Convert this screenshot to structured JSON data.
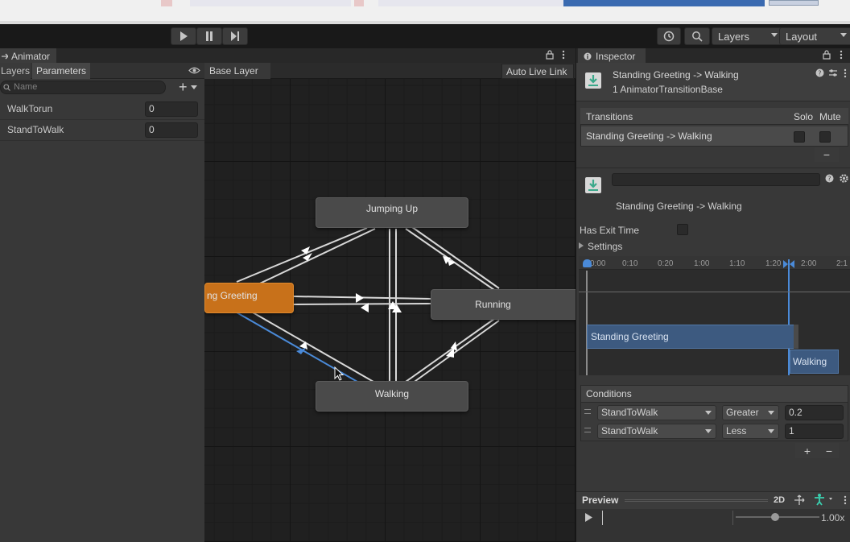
{
  "toolbar": {
    "layers_dropdown": "Layers",
    "layout_dropdown": "Layout"
  },
  "animator": {
    "tab_title": "Animator",
    "tabs": [
      "Layers",
      "Parameters"
    ],
    "search_placeholder": "Name",
    "add_symbol": "+",
    "parameters": [
      {
        "name": "WalkTorun",
        "value": "0"
      },
      {
        "name": "StandToWalk",
        "value": "0"
      }
    ],
    "breadcrumb": "Base Layer",
    "auto_live_link": "Auto Live Link",
    "nodes": {
      "jumping_up": "Jumping Up",
      "standing_greeting": "ng Greeting",
      "running": "Running",
      "walking": "Walking"
    }
  },
  "inspector": {
    "tab_title": "Inspector",
    "header_title": "Standing Greeting -> Walking",
    "header_subtitle": "1 AnimatorTransitionBase",
    "transitions": {
      "title": "Transitions",
      "solo": "Solo",
      "mute": "Mute",
      "rows": [
        "Standing Greeting -> Walking"
      ],
      "remove_symbol": "−"
    },
    "transition_name": "Standing Greeting -> Walking",
    "has_exit_time_label": "Has Exit Time",
    "settings_label": "Settings",
    "timeline": {
      "ticks": [
        "0:00",
        "0:10",
        "0:20",
        "1:00",
        "1:10",
        "1:20",
        "2:00",
        "2:1"
      ],
      "source_clip": "Standing Greeting",
      "dest_clip": "Walking"
    },
    "conditions": {
      "title": "Conditions",
      "rows": [
        {
          "parameter": "StandToWalk",
          "mode": "Greater",
          "threshold": "0.2"
        },
        {
          "parameter": "StandToWalk",
          "mode": "Less",
          "threshold": "1"
        }
      ],
      "add_symbol": "+",
      "remove_symbol": "−"
    },
    "preview": {
      "title": "Preview",
      "mode_2d": "2D",
      "speed": "1.00x"
    }
  },
  "colors": {
    "selected_state": "#c8711a",
    "transition_highlight": "#4a8ad8",
    "clip_bar": "#3d5a80"
  }
}
